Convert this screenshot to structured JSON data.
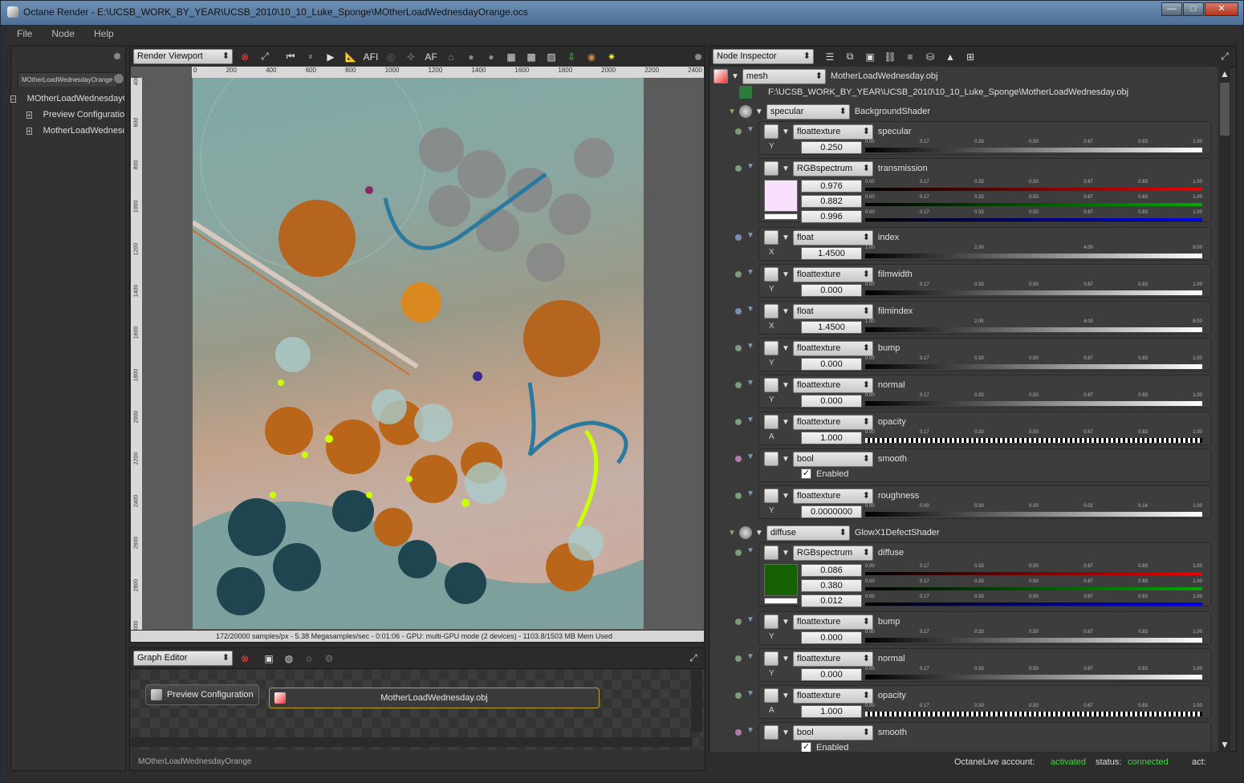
{
  "window": {
    "title": "Octane Render - E:\\UCSB_WORK_BY_YEAR\\UCSB_2010\\10_10_Luke_Sponge\\MOtherLoadWednesdayOrange.ocs"
  },
  "menu": [
    "File",
    "Node",
    "Help"
  ],
  "scene_tree": {
    "tab": "MOtherLoadWednesdayOrange",
    "items": [
      "MOtherLoadWednesdayOrange",
      "Preview Configuration",
      "MotherLoadWednesday.obj"
    ]
  },
  "render_viewport": {
    "combo": "Render Viewport",
    "ruler_top": [
      "0",
      "200",
      "400",
      "600",
      "800",
      "1000",
      "1200",
      "1400",
      "1600",
      "1800",
      "2000",
      "2200",
      "2400"
    ],
    "ruler_left": [
      "400",
      "600",
      "800",
      "1000",
      "1200",
      "1400",
      "1600",
      "1800",
      "2000",
      "2200",
      "2400",
      "2600",
      "2800",
      "3000"
    ],
    "status": "172/20000 samples/px - 5.38 Megasamples/sec - 0:01:06 - GPU: multi-GPU mode (2 devices) - 1103.8/1503 MB Mem Used"
  },
  "graph_editor": {
    "combo": "Graph Editor",
    "node_preview": "Preview Configuration",
    "node_mesh": "MotherLoadWednesday.obj",
    "tab": "MOtherLoadWednesdayOrange"
  },
  "inspector": {
    "combo": "Node Inspector",
    "mesh_type": "mesh",
    "mesh_name": "MotherLoadWednesday.obj",
    "mesh_path": "F:\\UCSB_WORK_BY_YEAR\\UCSB_2010\\10_10_Luke_Sponge\\MotherLoadWednesday.obj",
    "specular": {
      "type": "specular",
      "name": "BackgroundShader"
    },
    "diffuse": {
      "type": "diffuse",
      "name": "GlowX1DefectShader"
    },
    "ticks": [
      "0.00",
      "0.17",
      "0.33",
      "0.50",
      "0.67",
      "0.83",
      "1.00"
    ],
    "index_ticks": [
      "1.00",
      "2.00",
      "4.00",
      "8.00"
    ],
    "rough_ticks": [
      "0.00",
      "0.00",
      "0.00",
      "0.00",
      "0.02",
      "0.14",
      "1.00"
    ]
  },
  "params": [
    {
      "type": "floattexture",
      "name": "specular",
      "ch": "Y",
      "value": "0.250",
      "level": 0.25
    },
    {
      "type": "RGBspectrum",
      "name": "transmission",
      "r": "0.976",
      "g": "0.882",
      "b": "0.996",
      "color": "#f9e1fe"
    },
    {
      "type": "float",
      "name": "index",
      "ch": "X",
      "value": "1.4500"
    },
    {
      "type": "floattexture",
      "name": "filmwidth",
      "ch": "Y",
      "value": "0.000"
    },
    {
      "type": "float",
      "name": "filmindex",
      "ch": "X",
      "value": "1.4500"
    },
    {
      "type": "floattexture",
      "name": "bump",
      "ch": "Y",
      "value": "0.000"
    },
    {
      "type": "floattexture",
      "name": "normal",
      "ch": "Y",
      "value": "0.000"
    },
    {
      "type": "floattexture",
      "name": "opacity",
      "ch": "A",
      "value": "1.000"
    },
    {
      "type": "bool",
      "name": "smooth",
      "check": "Enabled"
    },
    {
      "type": "floattexture",
      "name": "roughness",
      "ch": "Y",
      "value": "0.0000000"
    },
    {
      "type": "RGBspectrum",
      "name": "diffuse",
      "r": "0.086",
      "g": "0.380",
      "b": "0.012",
      "color": "#166103"
    },
    {
      "type": "floattexture",
      "name": "bump",
      "ch": "Y",
      "value": "0.000"
    },
    {
      "type": "floattexture",
      "name": "normal",
      "ch": "Y",
      "value": "0.000"
    },
    {
      "type": "floattexture",
      "name": "opacity",
      "ch": "A",
      "value": "1.000"
    },
    {
      "type": "bool",
      "name": "smooth",
      "check": "Enabled"
    }
  ],
  "footer": {
    "account_label": "OctaneLive account:",
    "account_value": "activated",
    "status_label": "status:",
    "status_value": "connected",
    "act_label": "act:"
  },
  "colors": {
    "accent_green": "#33dd33",
    "panel": "#323232"
  }
}
